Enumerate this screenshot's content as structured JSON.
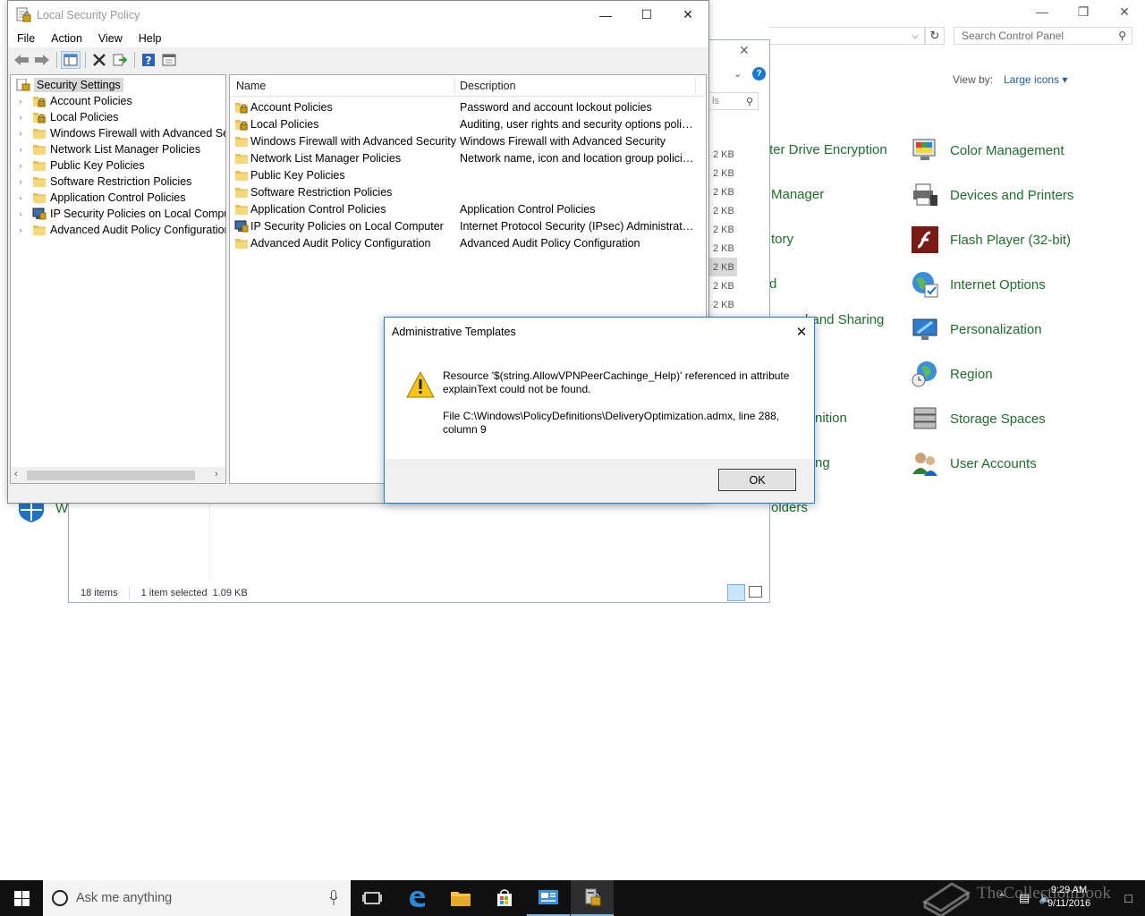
{
  "control_panel": {
    "search_placeholder": "Search Control Panel",
    "view_by_label": "View by:",
    "view_by_value": "Large icons",
    "left_fragments": [
      "ter Drive Encryption",
      "Manager",
      "tory",
      "d",
      "l and Sharing",
      "nition",
      "ng",
      "olders"
    ],
    "items": [
      {
        "label": "Color Management",
        "icon": "color-management-icon"
      },
      {
        "label": "Devices and Printers",
        "icon": "printer-icon"
      },
      {
        "label": "Flash Player (32-bit)",
        "icon": "flash-icon"
      },
      {
        "label": "Internet Options",
        "icon": "globe-icon"
      },
      {
        "label": "Personalization",
        "icon": "monitor-icon"
      },
      {
        "label": "Region",
        "icon": "region-globe-icon"
      },
      {
        "label": "Storage Spaces",
        "icon": "storage-icon"
      },
      {
        "label": "User Accounts",
        "icon": "users-icon"
      }
    ],
    "bottom_fragment": "W"
  },
  "explorer": {
    "search_fragment": "ls",
    "sizes": [
      "2 KB",
      "2 KB",
      "2 KB",
      "2 KB",
      "2 KB",
      "2 KB",
      "2 KB",
      "2 KB",
      "2 KB"
    ],
    "selected_size_index": 6,
    "status": {
      "items": "18 items",
      "selected": "1 item selected",
      "size": "1.09 KB"
    }
  },
  "lsp": {
    "title": "Local Security Policy",
    "menu": [
      "File",
      "Action",
      "View",
      "Help"
    ],
    "tree": {
      "root": "Security Settings",
      "items": [
        {
          "label": "Account Policies",
          "icon": "lock-folder-icon"
        },
        {
          "label": "Local Policies",
          "icon": "lock-folder-icon"
        },
        {
          "label": "Windows Firewall with Advanced Security",
          "icon": "folder-icon"
        },
        {
          "label": "Network List Manager Policies",
          "icon": "folder-icon"
        },
        {
          "label": "Public Key Policies",
          "icon": "folder-icon"
        },
        {
          "label": "Software Restriction Policies",
          "icon": "folder-icon"
        },
        {
          "label": "Application Control Policies",
          "icon": "folder-icon"
        },
        {
          "label": "IP Security Policies on Local Computer",
          "icon": "ipsec-icon"
        },
        {
          "label": "Advanced Audit Policy Configuration",
          "icon": "folder-icon"
        }
      ]
    },
    "list": {
      "columns": [
        "Name",
        "Description"
      ],
      "rows": [
        {
          "name": "Account Policies",
          "desc": "Password and account lockout policies",
          "icon": "lock-folder-icon"
        },
        {
          "name": "Local Policies",
          "desc": "Auditing, user rights and security options polici...",
          "icon": "lock-folder-icon"
        },
        {
          "name": "Windows Firewall with Advanced Security",
          "desc": "Windows Firewall with Advanced Security",
          "icon": "folder-icon"
        },
        {
          "name": "Network List Manager Policies",
          "desc": "Network name, icon and location group policies.",
          "icon": "folder-icon"
        },
        {
          "name": "Public Key Policies",
          "desc": "",
          "icon": "folder-icon"
        },
        {
          "name": "Software Restriction Policies",
          "desc": "",
          "icon": "folder-icon"
        },
        {
          "name": "Application Control Policies",
          "desc": "Application Control Policies",
          "icon": "folder-icon"
        },
        {
          "name": "IP Security Policies on Local Computer",
          "desc": "Internet Protocol Security (IPsec) Administratio...",
          "icon": "ipsec-icon"
        },
        {
          "name": "Advanced Audit Policy Configuration",
          "desc": "Advanced Audit Policy Configuration",
          "icon": "folder-icon"
        }
      ]
    }
  },
  "dialog": {
    "title": "Administrative Templates",
    "message": "Resource '$(string.AllowVPNPeerCachinge_Help)' referenced in attribute explainText could not be found.",
    "detail": "File C:\\Windows\\PolicyDefinitions\\DeliveryOptimization.admx, line 288, column 9",
    "ok_label": "OK"
  },
  "taskbar": {
    "search_placeholder": "Ask me anything",
    "time": "9:29 AM",
    "date": "9/11/2016",
    "watermark": "TheCollectionBook"
  },
  "colors": {
    "cp_link": "#1e6e2a",
    "accent": "#1883d7",
    "taskbar": "#101010"
  }
}
